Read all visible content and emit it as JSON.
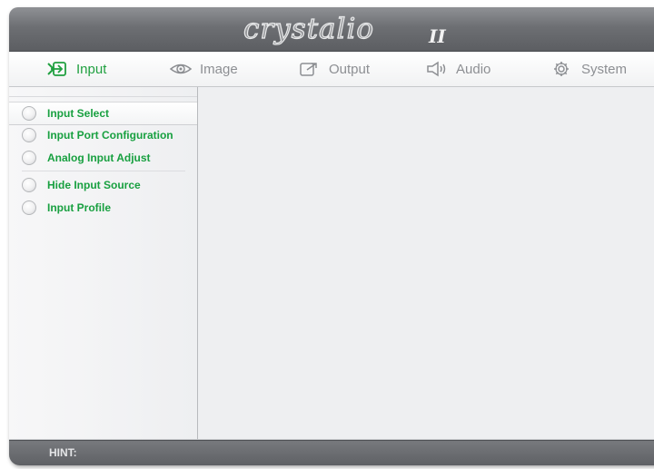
{
  "header": {
    "logo_text": "crystalio",
    "logo_suffix": "II"
  },
  "tabs": [
    {
      "id": "input",
      "label": "Input",
      "icon": "input-icon",
      "active": true
    },
    {
      "id": "image",
      "label": "Image",
      "icon": "eye-icon",
      "active": false
    },
    {
      "id": "output",
      "label": "Output",
      "icon": "output-icon",
      "active": false
    },
    {
      "id": "audio",
      "label": "Audio",
      "icon": "speaker-icon",
      "active": false
    },
    {
      "id": "system",
      "label": "System",
      "icon": "gear-icon",
      "active": false
    }
  ],
  "sidebar": {
    "items": [
      {
        "label": "Input Select",
        "selected": true
      },
      {
        "label": "Input Port Configuration",
        "selected": false
      },
      {
        "label": "Analog Input Adjust",
        "selected": false
      },
      {
        "label": "Hide Input Source",
        "selected": false
      },
      {
        "label": "Input Profile",
        "selected": false
      }
    ]
  },
  "footer": {
    "hint_label": "HINT:"
  },
  "colors": {
    "accent_green": "#18a040",
    "inactive_tab": "#8d8f93",
    "titlebar": "#6d6f73"
  }
}
